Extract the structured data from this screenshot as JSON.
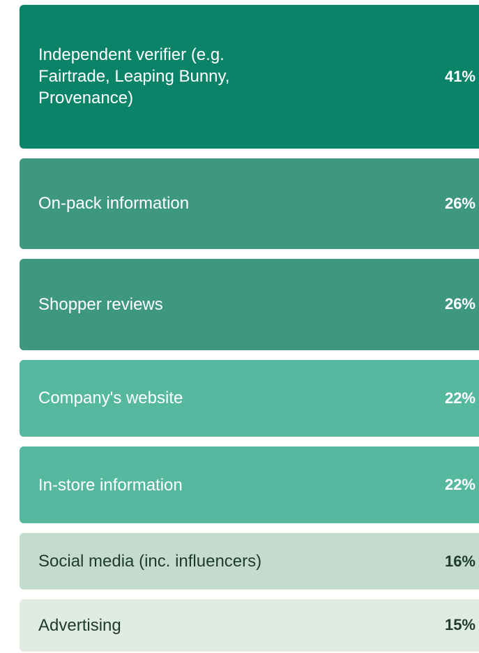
{
  "chart_data": {
    "type": "bar",
    "orientation": "horizontal",
    "categories": [
      "Independent verifier (e.g. Fairtrade, Leaping Bunny, Provenance)",
      "On-pack information",
      "Shopper reviews",
      "Company's website",
      "In-store information",
      "Social media (inc. influencers)",
      "Advertising"
    ],
    "values": [
      41,
      26,
      26,
      22,
      22,
      16,
      15
    ],
    "value_labels": [
      "41%",
      "26%",
      "26%",
      "22%",
      "22%",
      "16%",
      "15%"
    ],
    "unit": "%",
    "colors": [
      "#0b8369",
      "#3e9880",
      "#3e9880",
      "#55b89f",
      "#55b89f",
      "#c4dccd",
      "#e0ebe2"
    ],
    "text_colors": [
      "#ffffff",
      "#ffffff",
      "#ffffff",
      "#ffffff",
      "#ffffff",
      "#1e3a30",
      "#1e3a30"
    ]
  }
}
